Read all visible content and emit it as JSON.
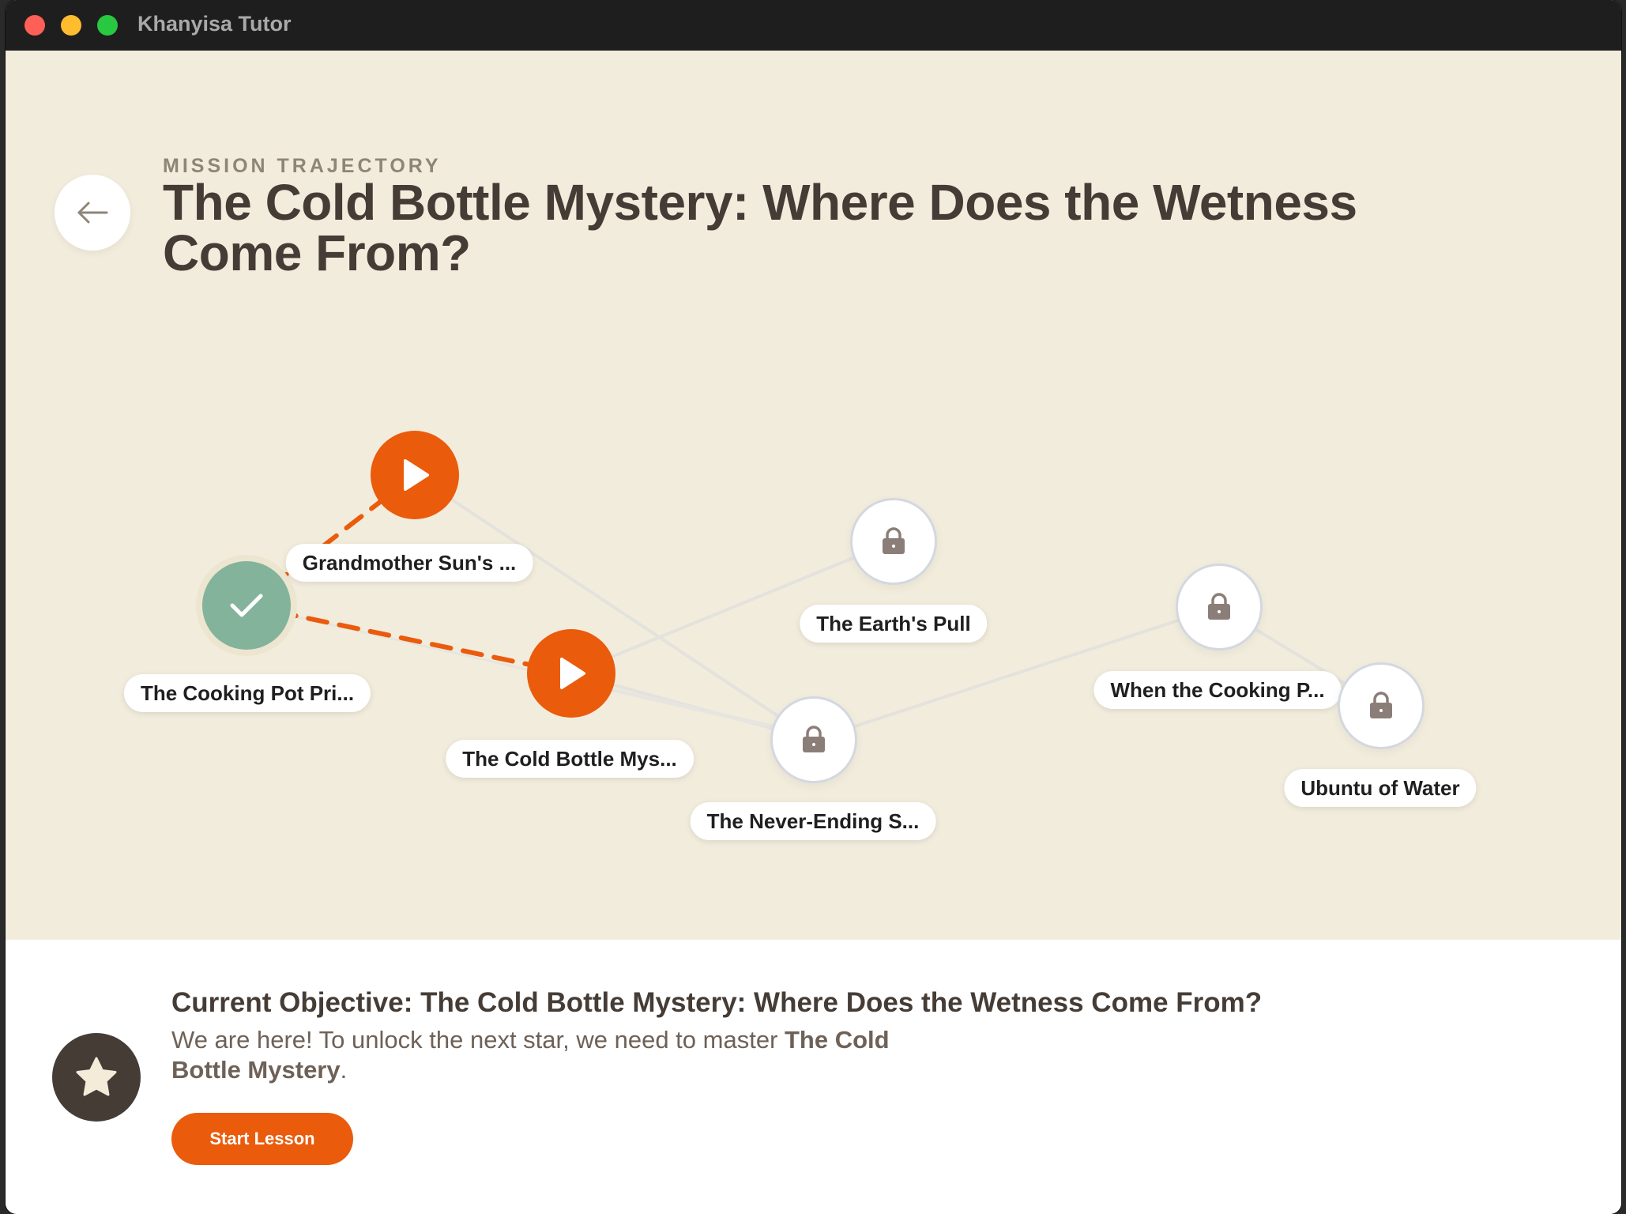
{
  "window": {
    "title": "Khanyisa Tutor"
  },
  "header": {
    "eyebrow": "MISSION TRAJECTORY",
    "title": "The Cold Bottle Mystery: Where Does the Wetness Come From?"
  },
  "nodes": [
    {
      "id": "cooking-pot",
      "label": "The Cooking Pot Pri...",
      "status": "completed",
      "icon": "check-icon"
    },
    {
      "id": "grandmother-sun",
      "label": "Grandmother Sun's ...",
      "status": "available",
      "icon": "play-icon"
    },
    {
      "id": "cold-bottle",
      "label": "The Cold Bottle Mys...",
      "status": "current",
      "icon": "play-icon"
    },
    {
      "id": "earths-pull",
      "label": "The Earth's Pull",
      "status": "locked",
      "icon": "lock-icon"
    },
    {
      "id": "never-ending",
      "label": "The Never-Ending S...",
      "status": "locked",
      "icon": "lock-icon"
    },
    {
      "id": "when-cooking",
      "label": "When the Cooking P...",
      "status": "locked",
      "icon": "lock-icon"
    },
    {
      "id": "ubuntu-water",
      "label": "Ubuntu of Water",
      "status": "locked",
      "icon": "lock-icon"
    }
  ],
  "objective": {
    "title": "Current Objective: The Cold Bottle Mystery: Where Does the Wetness Come From?",
    "desc_prefix": "We are here! To unlock the next star, we need to master ",
    "desc_bold": "The Cold Bottle Mystery",
    "desc_suffix": ".",
    "button_label": "Start Lesson",
    "icon": "star-icon"
  },
  "colors": {
    "accent": "#ea5b0c",
    "completed": "#83b39b",
    "background": "#f2ecdd",
    "text_dark": "#453c36"
  }
}
